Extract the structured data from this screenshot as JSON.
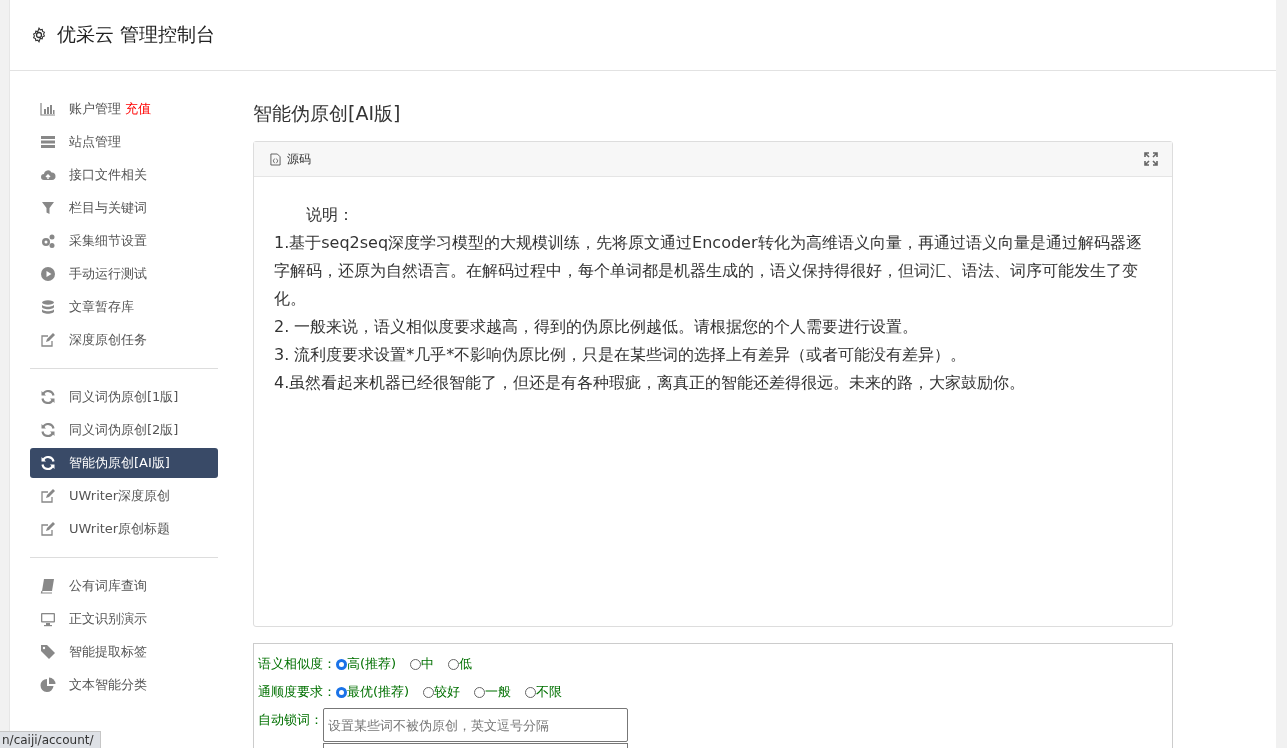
{
  "header": {
    "title": "优采云 管理控制台"
  },
  "sidebar": {
    "groups": [
      {
        "items": [
          {
            "kind": "bars",
            "label": "账户管理",
            "badge": "充值",
            "selected": false
          },
          {
            "kind": "server",
            "label": "站点管理",
            "selected": false
          },
          {
            "kind": "cloud",
            "label": "接口文件相关",
            "selected": false
          },
          {
            "kind": "filter",
            "label": "栏目与关键词",
            "selected": false
          },
          {
            "kind": "gears",
            "label": "采集细节设置",
            "selected": false
          },
          {
            "kind": "play",
            "label": "手动运行测试",
            "selected": false
          },
          {
            "kind": "database",
            "label": "文章暂存库",
            "selected": false
          },
          {
            "kind": "edit",
            "label": "深度原创任务",
            "selected": false
          }
        ]
      },
      {
        "items": [
          {
            "kind": "refresh",
            "label": "同义词伪原创[1版]",
            "selected": false
          },
          {
            "kind": "refresh",
            "label": "同义词伪原创[2版]",
            "selected": false
          },
          {
            "kind": "refresh",
            "label": "智能伪原创[AI版]",
            "selected": true
          },
          {
            "kind": "edit",
            "label": "UWriter深度原创",
            "selected": false
          },
          {
            "kind": "edit",
            "label": "UWriter原创标题",
            "selected": false
          }
        ]
      },
      {
        "items": [
          {
            "kind": "book",
            "label": "公有词库查询",
            "selected": false
          },
          {
            "kind": "monitor",
            "label": "正文识别演示",
            "selected": false
          },
          {
            "kind": "tag",
            "label": "智能提取标签",
            "selected": false
          },
          {
            "kind": "pie",
            "label": "文本智能分类",
            "selected": false
          }
        ]
      }
    ]
  },
  "page_title": "智能伪原创[AI版]",
  "editor": {
    "toolbar_label": "源码",
    "heading": "说明：",
    "paragraphs": [
      "1.基于seq2seq深度学习模型的大规模训练，先将原文通过Encoder转化为高维语义向量，再通过语义向量是通过解码器逐字解码，还原为自然语言。在解码过程中，每个单词都是机器生成的，语义保持得很好，但词汇、语法、词序可能发生了变化。",
      "2. 一般来说，语义相似度要求越高，得到的伪原比例越低。请根据您的个人需要进行设置。",
      "3. 流利度要求设置*几乎*不影响伪原比例，只是在某些词的选择上有差异（或者可能没有差异）。",
      "4.虽然看起来机器已经很智能了，但还是有各种瑕疵，离真正的智能还差得很远。未来的路，大家鼓励你。"
    ]
  },
  "form": [
    {
      "kind": "radio",
      "label": "语义相似度：",
      "options": [
        {
          "label": "高(推荐)",
          "selected": true
        },
        {
          "label": "中",
          "selected": false
        },
        {
          "label": "低",
          "selected": false
        }
      ]
    },
    {
      "kind": "radio",
      "label": "通顺度要求：",
      "options": [
        {
          "label": "最优(推荐)",
          "selected": true
        },
        {
          "label": "较好",
          "selected": false
        },
        {
          "label": "一般",
          "selected": false
        },
        {
          "label": "不限",
          "selected": false
        }
      ]
    },
    {
      "kind": "text",
      "label": "自动锁词：",
      "placeholder": "设置某些词不被伪原创，英文逗号分隔"
    }
  ],
  "status_url": "n/caiji/account/"
}
